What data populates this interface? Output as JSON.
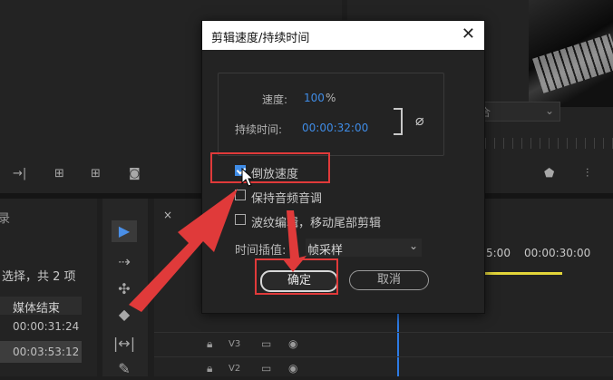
{
  "background": {
    "project_partial_text": "录",
    "project_selection_text": "选择，共 2 项",
    "column_header": "媒体结束",
    "rows": [
      "00:00:31:24",
      "00:03:53:12"
    ],
    "blend_dropdown": "合",
    "timeline_times": [
      "5:00",
      "00:00:30:00"
    ],
    "tracks": [
      "V3",
      "V2"
    ],
    "timeline_close": "×"
  },
  "dialog": {
    "title": "剪辑速度/持续时间",
    "speed_label": "速度:",
    "speed_value": "100",
    "speed_unit": "%",
    "duration_label": "持续时间:",
    "duration_value": "00:00:32:00",
    "reverse_label": "倒放速度",
    "reverse_checked": true,
    "maintain_audio_label": "保持音频音调",
    "maintain_audio_checked": false,
    "ripple_label": "波纹编辑，移动尾部剪辑",
    "ripple_checked": false,
    "interp_label": "时间插值:",
    "interp_value": "帧采样",
    "ok_label": "确定",
    "cancel_label": "取消"
  },
  "icons": [
    "close-icon",
    "link-icon",
    "dropdown-arrow-icon",
    "selection-tool-icon"
  ],
  "colors": {
    "accent": "#3f8ce6",
    "highlight": "#e03a3a"
  }
}
